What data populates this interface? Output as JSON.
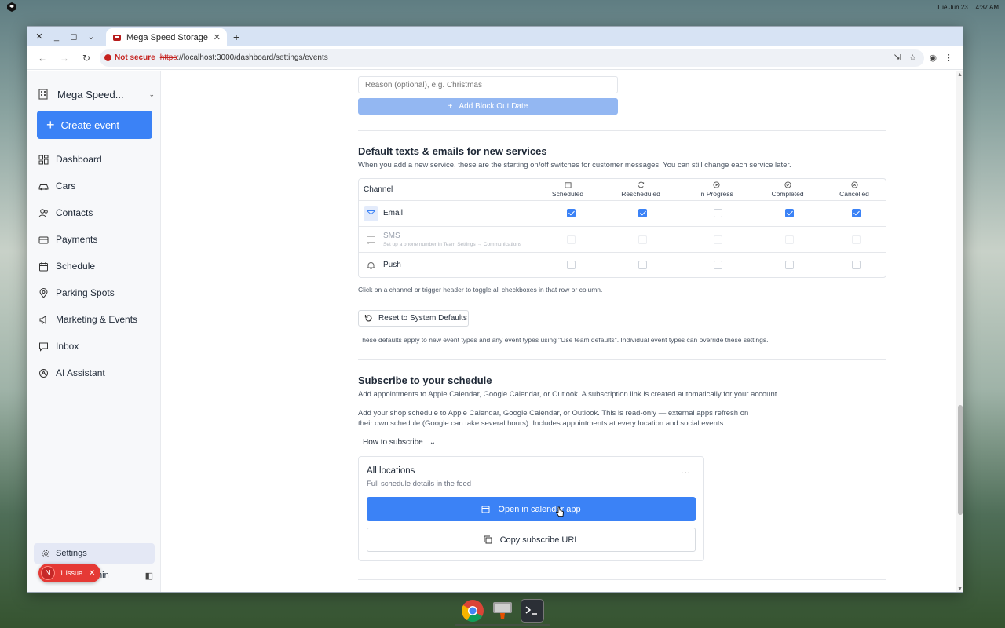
{
  "desktop": {
    "date": "Tue Jun 23",
    "time": "4:37 AM"
  },
  "browser": {
    "tab_title": "Mega Speed Storage",
    "security_label": "Not secure",
    "url_scheme": "https",
    "url_rest": "://localhost:3000/dashboard/settings/events"
  },
  "sidebar": {
    "org_name": "Mega Speed...",
    "create_label": "Create event",
    "items": [
      {
        "label": "Dashboard",
        "icon": "dashboard-icon"
      },
      {
        "label": "Cars",
        "icon": "car-icon"
      },
      {
        "label": "Contacts",
        "icon": "contacts-icon"
      },
      {
        "label": "Payments",
        "icon": "payments-icon"
      },
      {
        "label": "Schedule",
        "icon": "calendar-icon"
      },
      {
        "label": "Parking Spots",
        "icon": "pin-icon"
      },
      {
        "label": "Marketing & Events",
        "icon": "megaphone-icon"
      },
      {
        "label": "Inbox",
        "icon": "inbox-icon"
      },
      {
        "label": "AI Assistant",
        "icon": "ai-icon"
      }
    ],
    "settings_label": "Settings",
    "user_name": "min",
    "issue_avatar": "N",
    "issue_label": "1 Issue"
  },
  "blockout": {
    "reason_placeholder": "Reason (optional), e.g. Christmas",
    "add_label": "Add Block Out Date"
  },
  "defaults": {
    "title": "Default texts & emails for new services",
    "description": "When you add a new service, these are the starting on/off switches for customer messages. You can still change each service later.",
    "channel_header": "Channel",
    "columns": [
      "Scheduled",
      "Rescheduled",
      "In Progress",
      "Completed",
      "Cancelled"
    ],
    "rows": [
      {
        "label": "Email",
        "hint": "",
        "checks": [
          true,
          true,
          false,
          true,
          true
        ],
        "disabled": false
      },
      {
        "label": "SMS",
        "hint": "Set up a phone number in Team Settings → Communications",
        "checks": [
          false,
          false,
          false,
          false,
          false
        ],
        "disabled": true
      },
      {
        "label": "Push",
        "hint": "",
        "checks": [
          false,
          false,
          false,
          false,
          false
        ],
        "disabled": false
      }
    ],
    "toggle_hint": "Click on a channel or trigger header to toggle all checkboxes in that row or column.",
    "reset_label": "Reset to System Defaults",
    "apply_note": "These defaults apply to new event types and any event types using \"Use team defaults\". Individual event types can override these settings."
  },
  "subscribe": {
    "title": "Subscribe to your schedule",
    "line1": "Add appointments to Apple Calendar, Google Calendar, or Outlook. A subscription link is created automatically for your account.",
    "line2a": "Add your shop schedule to Apple Calendar, Google Calendar, or Outlook. This is read-only — external apps refresh on",
    "line2b": "their own schedule (Google can take several hours). Includes appointments at every location and social events.",
    "howto_label": "How to subscribe",
    "card_title": "All locations",
    "card_subtitle": "Full schedule details in the feed",
    "more_label": "...",
    "open_label": "Open in calendar app",
    "copy_label": "Copy subscribe URL"
  }
}
